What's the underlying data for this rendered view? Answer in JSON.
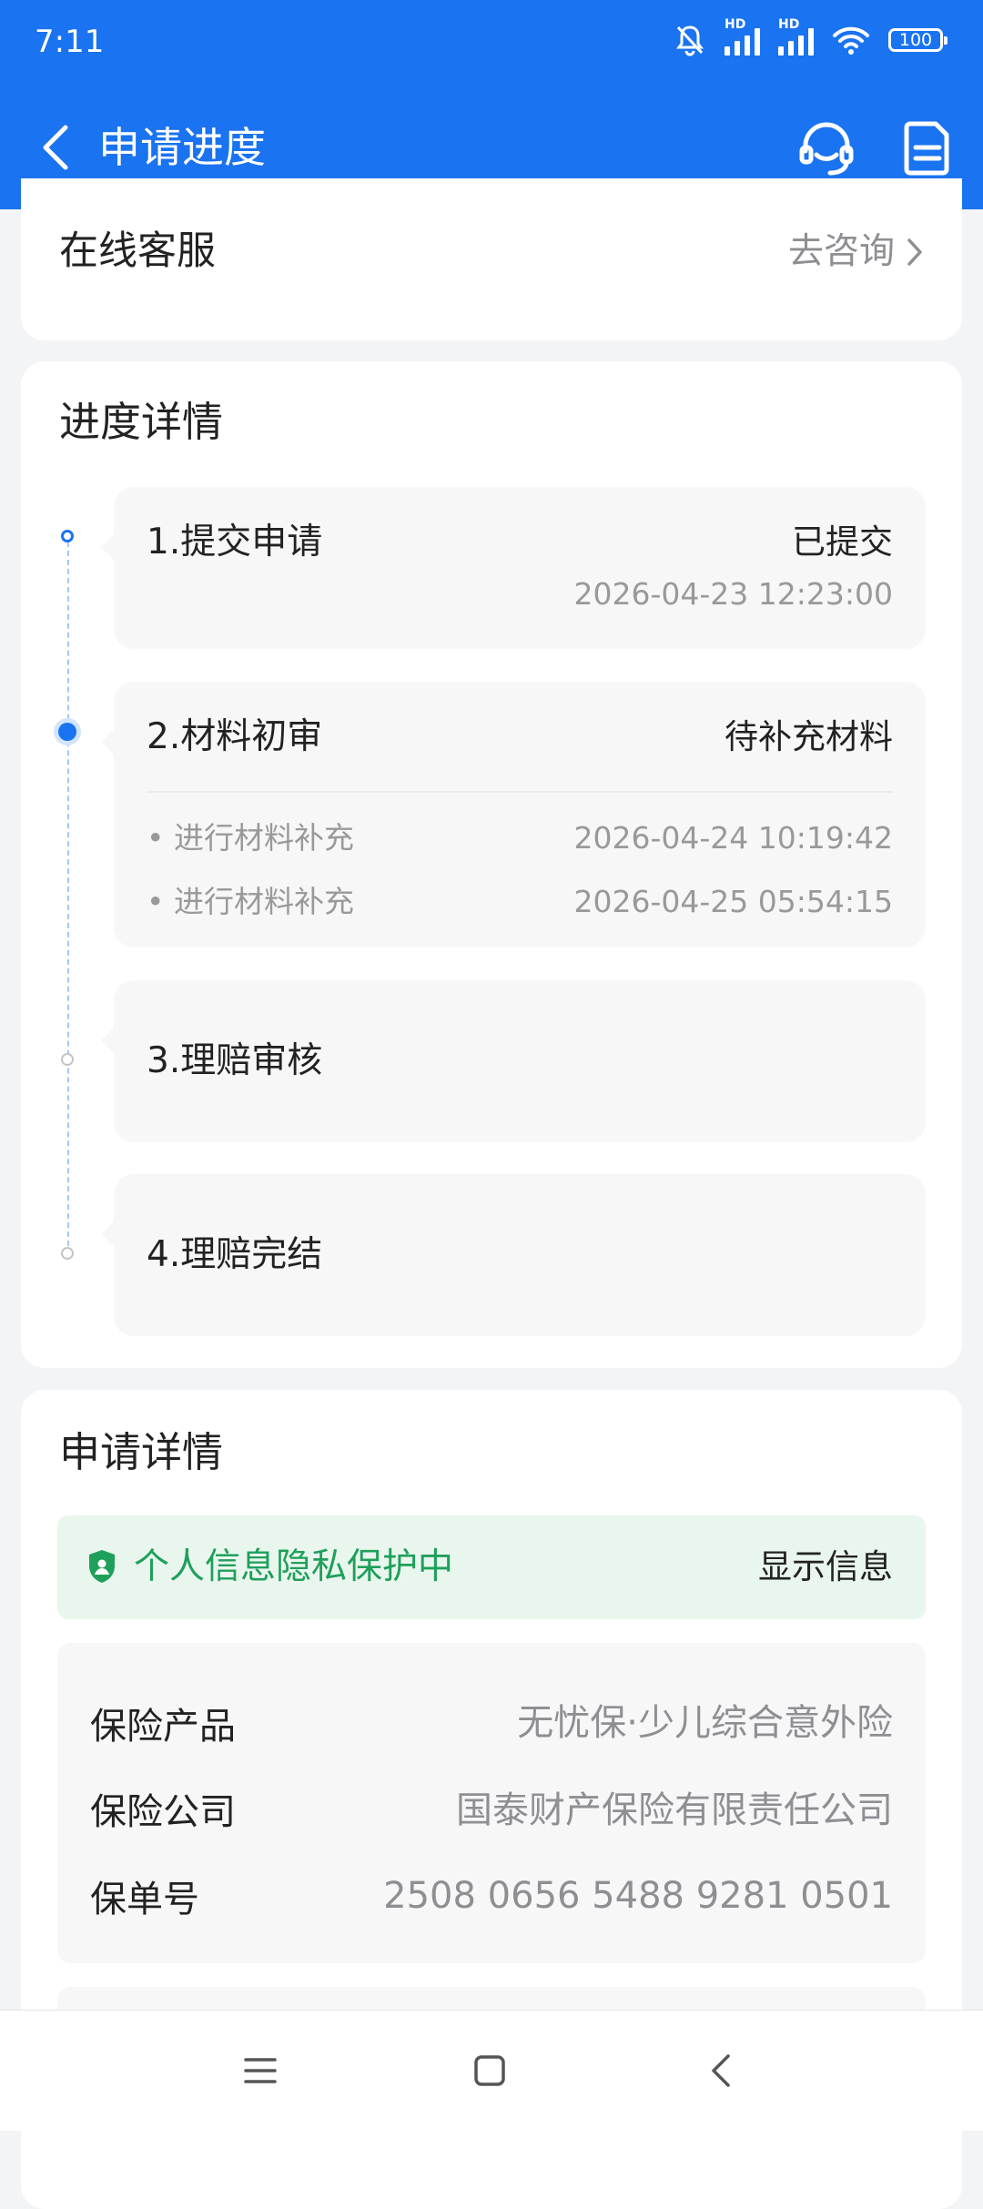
{
  "status_bar": {
    "time": "7:11",
    "sim1_badge": "HD",
    "sim2_badge": "HD",
    "battery": "100"
  },
  "header": {
    "title": "申请进度",
    "bg_color": "#1a73f0"
  },
  "customer_service": {
    "title": "在线客服",
    "link_label": "去咨询"
  },
  "progress": {
    "section_title": "进度详情",
    "steps": [
      {
        "label": "1.提交申请",
        "status": "已提交",
        "time": "2026-04-23 12:23:00"
      },
      {
        "label": "2.材料初审",
        "status": "待补充材料",
        "sub_items": [
          {
            "label": "• 进行材料补充",
            "time": "2026-04-24 10:19:42"
          },
          {
            "label": "• 进行材料补充",
            "time": "2026-04-25 05:54:15"
          }
        ]
      },
      {
        "label": "3.理赔审核"
      },
      {
        "label": "4.理赔完结"
      }
    ]
  },
  "application_details": {
    "section_title": "申请详情",
    "privacy": {
      "text": "个人信息隐私保护中",
      "action": "显示信息",
      "color": "#1ea05a"
    },
    "fields": [
      {
        "label": "保险产品",
        "value": "无忧保·少儿综合意外险"
      },
      {
        "label": "保险公司",
        "value": "国泰财产保险有限责任公司"
      },
      {
        "label": "保单号",
        "value": "2508 0656 5488 9281 0501"
      }
    ]
  }
}
